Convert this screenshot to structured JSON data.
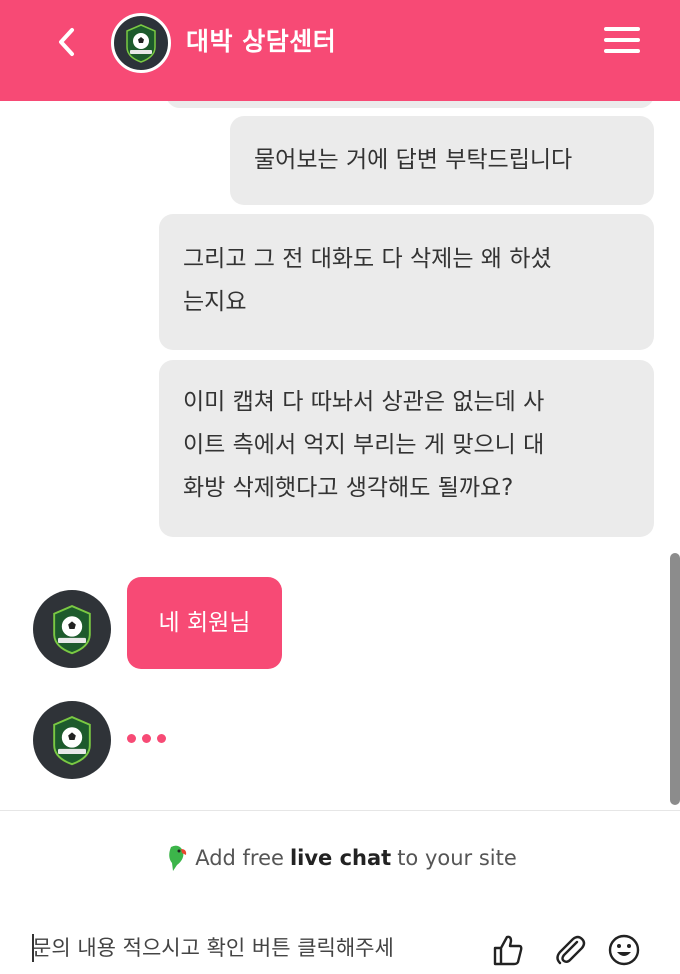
{
  "header": {
    "title": "대박 상담센터",
    "back_icon": "chevron-left-icon",
    "menu_icon": "hamburger-menu-icon",
    "logo_icon": "soccer-ball-logo"
  },
  "messages": {
    "user": [
      {
        "lines": [
          "물어보는 거에 답변 부탁드립니다"
        ]
      },
      {
        "lines": [
          "그리고 그 전 대화도 다 삭제는 왜 하셨",
          "는지요"
        ]
      },
      {
        "lines": [
          "이미 캡쳐 다 따놔서 상관은 없는데 사",
          "이트 측에서 억지 부리는 게 맞으니 대",
          "화방 삭제햇다고 생각해도 될까요?"
        ]
      }
    ],
    "agent": {
      "text": "네 회원님"
    },
    "typing_indicator": "..."
  },
  "promo": {
    "prefix": "Add free",
    "bold": "live chat",
    "suffix": "to your site",
    "icon": "parrot-icon"
  },
  "composer": {
    "placeholder": "문의 내용 적으시고 확인 버튼 클릭해주세",
    "value": "",
    "like_icon": "thumbs-up-icon",
    "attach_icon": "paperclip-icon",
    "emoji_icon": "smiley-icon"
  },
  "colors": {
    "brand": "#f74a75",
    "user_bubble": "#ebebeb",
    "avatar_bg": "#2f3338"
  }
}
